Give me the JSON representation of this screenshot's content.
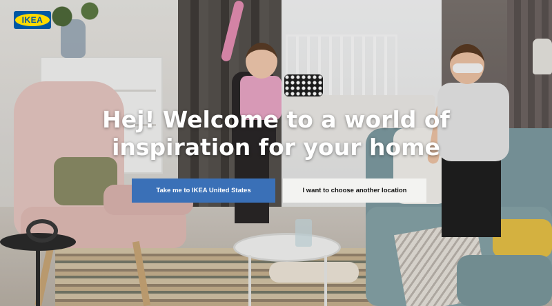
{
  "logo": {
    "text": "IKEA",
    "brand_blue": "#0058a3",
    "brand_yellow": "#ffdb00"
  },
  "hero": {
    "line1": "Hej! Welcome to a world of",
    "line2": "inspiration for your home"
  },
  "buttons": {
    "primary_label": "Take me to IKEA United States",
    "secondary_label": "I want to choose another location",
    "primary_color": "#3a70b7",
    "secondary_color": "#f3f3f1"
  }
}
